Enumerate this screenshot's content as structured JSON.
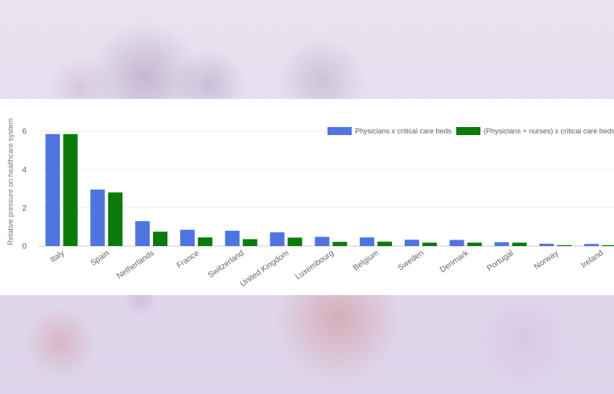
{
  "chart_data": {
    "type": "bar",
    "title": "",
    "xlabel": "",
    "ylabel": "Relative pressure on healthcare system",
    "ylim": [
      0,
      6.3
    ],
    "yticks": [
      0,
      2,
      4,
      6
    ],
    "grid": true,
    "legend_position": "top-right",
    "categories": [
      "Italy",
      "Spain",
      "Netherlands",
      "France",
      "Switzerland",
      "United Kingdom",
      "Luxembourg",
      "Belgium",
      "Sweden",
      "Denmark",
      "Portugal",
      "Norway",
      "Ireland"
    ],
    "series": [
      {
        "name": "Physicians x critical care beds",
        "color": "#4f74e0",
        "values": [
          5.85,
          2.95,
          1.3,
          0.85,
          0.8,
          0.72,
          0.48,
          0.45,
          0.33,
          0.32,
          0.2,
          0.12,
          0.11
        ]
      },
      {
        "name": "(Physicians + nurses) x critical care beds",
        "color": "#0a7a0a",
        "values": [
          5.85,
          2.8,
          0.75,
          0.45,
          0.36,
          0.44,
          0.22,
          0.23,
          0.18,
          0.18,
          0.18,
          0.05,
          0.05
        ]
      }
    ]
  },
  "background": {
    "color": "#e6dfef",
    "virus_colors": [
      "#7a5a8a",
      "#c9706e",
      "#b88fb5"
    ]
  }
}
